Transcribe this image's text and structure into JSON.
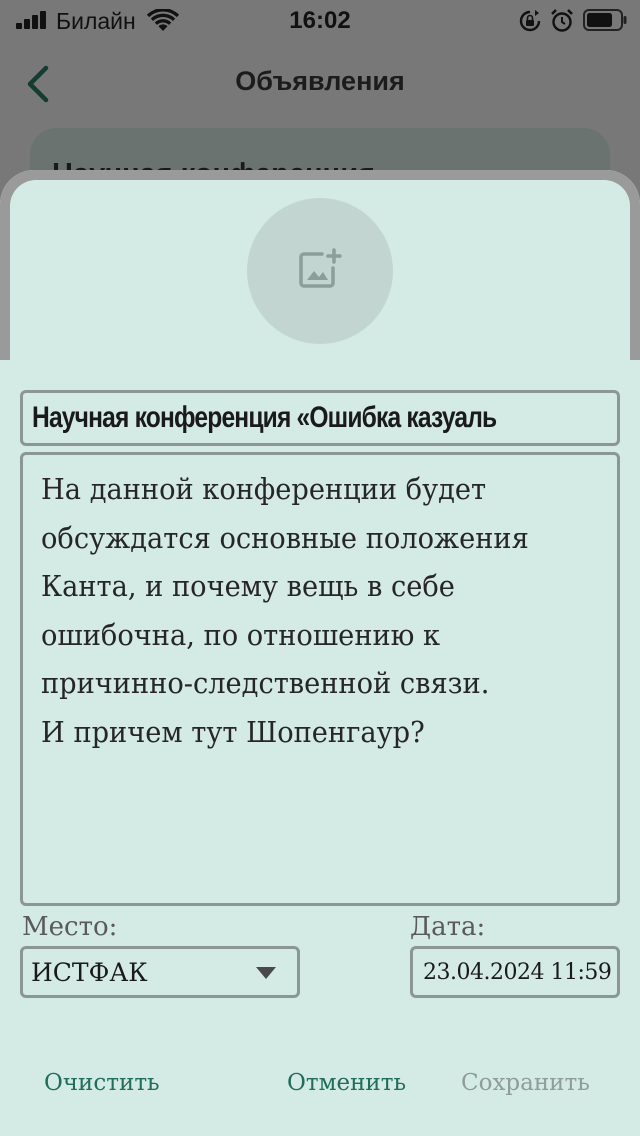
{
  "status_bar": {
    "carrier": "Билайн",
    "time": "16:02",
    "icons": [
      "cellular-signal-icon",
      "wifi-icon",
      "rotation-lock-icon",
      "alarm-icon",
      "battery-icon"
    ]
  },
  "background_screen": {
    "title": "Объявления",
    "card_title": "Научная конференция"
  },
  "form": {
    "title_value": "Научная конференция «Ошибка казуаль",
    "description_value": "На данной конференции будет\nобсуждатся основные положения\nКанта, и почему вещь в себе\nошибочна, по отношению к\nпричинно-следственной связи.\nИ причем тут Шопенгаур?",
    "place_label": "Место:",
    "place_value": "ИСТФАК",
    "date_label": "Дата:",
    "date_value": "23.04.2024 11:59"
  },
  "actions": {
    "clear_label": "Очистить",
    "cancel_label": "Отменить",
    "save_label": "Сохранить"
  },
  "colors": {
    "sheet_background": "#d4eae4",
    "accent": "#1e6e58",
    "disabled": "#8f9c98",
    "field_border": "#8c9693",
    "dim_overlay": "#787878"
  }
}
